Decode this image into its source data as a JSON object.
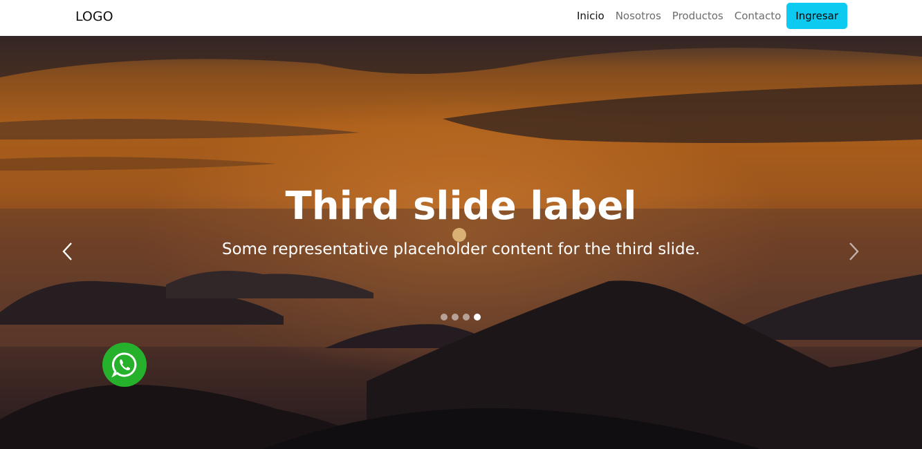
{
  "navbar": {
    "logo": "LOGO",
    "links": [
      {
        "label": "Inicio",
        "active": true
      },
      {
        "label": "Nosotros",
        "active": false
      },
      {
        "label": "Productos",
        "active": false
      },
      {
        "label": "Contacto",
        "active": false
      }
    ],
    "login_label": "Ingresar"
  },
  "carousel": {
    "title": "Third slide label",
    "text": "Some representative placeholder content for the third slide.",
    "indicator_count": 4,
    "active_index": 3
  },
  "icons": {
    "prev": "chevron-left-icon",
    "next": "chevron-right-icon",
    "whatsapp": "whatsapp-icon"
  },
  "colors": {
    "login_button": "#0dcaf0",
    "whatsapp": "#25b12b"
  }
}
